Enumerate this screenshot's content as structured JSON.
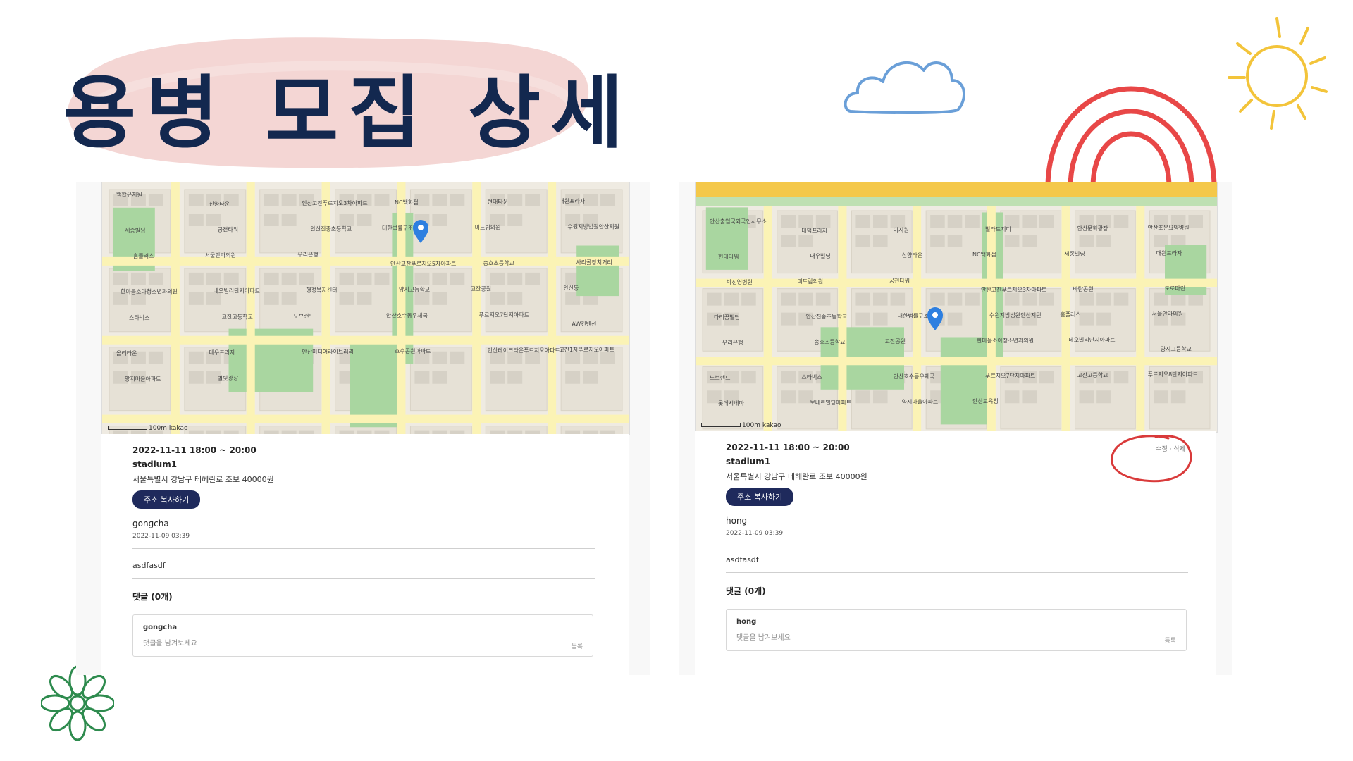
{
  "page": {
    "title": "용병 모집 상세",
    "colors": {
      "title_text": "#13284f",
      "title_blob": "#f2d3d3",
      "accent_button": "#1f2a5c",
      "highlight_circle": "#d93a3a",
      "rainbow_red": "#e84747",
      "sun_yellow": "#f3c43a",
      "cloud_blue": "#6a9fd8",
      "flower_green": "#2e8b4e",
      "map_pin": "#2d7fe0"
    }
  },
  "left_post": {
    "map_scale": "100m",
    "map_brand": "kakao",
    "map_labels": [
      "백합유치원",
      "신양타운",
      "안산고잔푸르지오3차아파트",
      "NC백화점",
      "현대타운",
      "대원프라자",
      "세종빌딩",
      "궁전타워",
      "안산진중초등학교",
      "대한법률구조공단",
      "미드림의원",
      "수원지방법원안산지원",
      "홈플러스",
      "서울안과의원",
      "우리은행",
      "안산고잔푸르지오5차아파트",
      "송호초등학교",
      "사리골장치거리",
      "한마음소아청소년과의원",
      "네오빌리단지아파트",
      "행정복지센터",
      "양지고등학교",
      "고잔공원",
      "안산동",
      "스타벅스",
      "고잔고등학교",
      "노브랜드",
      "안산호수동우체국",
      "푸르지오7단지아파트",
      "AW컨벤션",
      "올리타운",
      "대우프라자",
      "안산미디어라이브러리",
      "호수공원아파트",
      "안산레이크타운푸르지오아파트",
      "고잔1차푸르지오아파트",
      "양지마을아파트",
      "별빛광장"
    ],
    "date": "2022-11-11 18:00 ~ 20:00",
    "stadium": "stadium1",
    "address": "서울특별시 강남구 테헤란로 조보 40000원",
    "copy_button": "주소 복사하기",
    "author": "gongcha",
    "posted_at": "2022-11-09 03:39",
    "content": "asdfasdf",
    "comments_heading": "댓글 (0개)",
    "comment_user": "gongcha",
    "comment_placeholder": "댓글을 남겨보세요",
    "comment_submit": "등록"
  },
  "right_post": {
    "map_scale": "100m",
    "map_brand": "kakao",
    "map_labels": [
      "안산출입국외국인사무소",
      "대덕프라자",
      "이지원",
      "빌라드지디",
      "안산문화광장",
      "안산조은요양병원",
      "현대타워",
      "대우빌딩",
      "신양타운",
      "NC백화점",
      "세종빌딩",
      "대원프라자",
      "박진영병원",
      "미드림의원",
      "궁전타워",
      "안산고잔푸르지오3차아파트",
      "바람공원",
      "토로마린",
      "다리꿈빌딩",
      "안산진중초등학교",
      "대한법률구조공단",
      "수원지방법원안산지원",
      "홈플러스",
      "서울안과의원",
      "우리은행",
      "송호초등학교",
      "고잔공원",
      "한마음소아청소년과의원",
      "네오빌리단지아파트",
      "양지고등학교",
      "노브랜드",
      "스타벅스",
      "안산호수동우체국",
      "푸르지오7단지아파트",
      "고잔고등학교",
      "푸르지오8단지아파트",
      "롯데시네마",
      "보네르빌딩아파트",
      "양지마을아파트",
      "안산교육청"
    ],
    "date": "2022-11-11 18:00 ~ 20:00",
    "stadium": "stadium1",
    "address": "서울특별시 강남구 테헤란로 조보 40000원",
    "copy_button": "주소 복사하기",
    "edit_label": "수정",
    "separator": "·",
    "delete_label": "삭제",
    "author": "hong",
    "posted_at": "2022-11-09 03:39",
    "content": "asdfasdf",
    "comments_heading": "댓글 (0개)",
    "comment_user": "hong",
    "comment_placeholder": "댓글을 남겨보세요",
    "comment_submit": "등록"
  }
}
